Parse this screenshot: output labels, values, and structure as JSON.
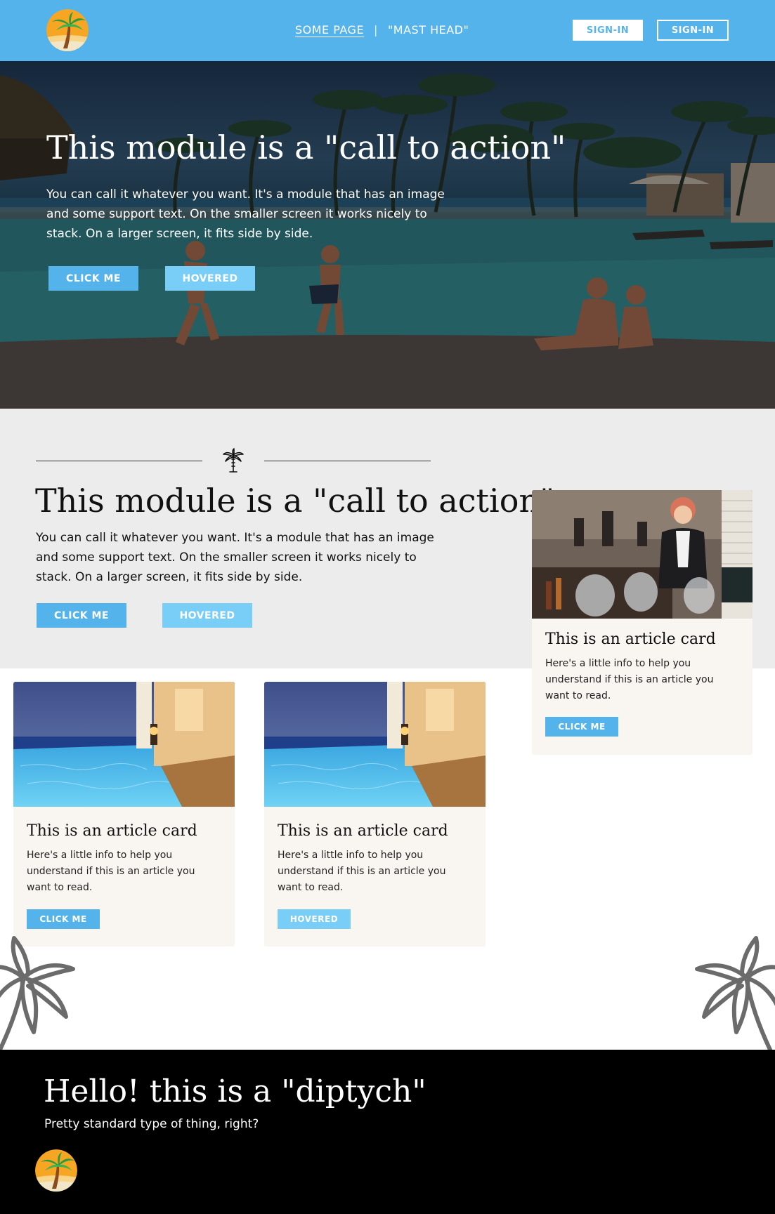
{
  "header": {
    "nav_link": "SOME PAGE",
    "nav_separator": "|",
    "nav_text": "\"MAST HEAD\"",
    "signin_primary": "SIGN-IN",
    "signin_secondary": "SIGN-IN",
    "logo_icon": "palm-tree-logo-icon"
  },
  "hero": {
    "title": "This module is a \"call to action\"",
    "text": "You can call it whatever you want. It's a module that has an image and some support text. On the smaller screen it works nicely to stack. On a larger screen, it fits side by side.",
    "button_primary": "CLICK ME",
    "button_hovered": "HOVERED"
  },
  "cta": {
    "divider_icon": "palm-tree-icon",
    "title": "This module is a \"call to action\"",
    "text": "You can call it whatever you want. It's a module that has an image and some support text. On the smaller screen it works nicely to stack. On a larger screen, it fits side by side.",
    "button_primary": "CLICK ME",
    "button_hovered": "HOVERED"
  },
  "cards": [
    {
      "title": "This is an article card",
      "text": "Here's a little info to help you understand if this is an article you want to read.",
      "button": "CLICK ME"
    },
    {
      "title": "This is an article card",
      "text": "Here's a little info to help you understand if this is an article you want to read.",
      "button": "HOVERED"
    },
    {
      "title": "This is an article card",
      "text": "Here's a little info to help you understand if this is an article you want to read.",
      "button": "CLICK ME"
    }
  ],
  "footer": {
    "title": "Hello! this is a \"diptych\"",
    "text": "Pretty standard type of thing, right?",
    "logo_icon": "palm-tree-logo-icon"
  },
  "colors": {
    "brand_blue": "#55b3ec",
    "hover_blue": "#79cef8",
    "section_gray": "#ececec",
    "card_bg": "#f9f5f1",
    "footer_bg": "#000000"
  }
}
